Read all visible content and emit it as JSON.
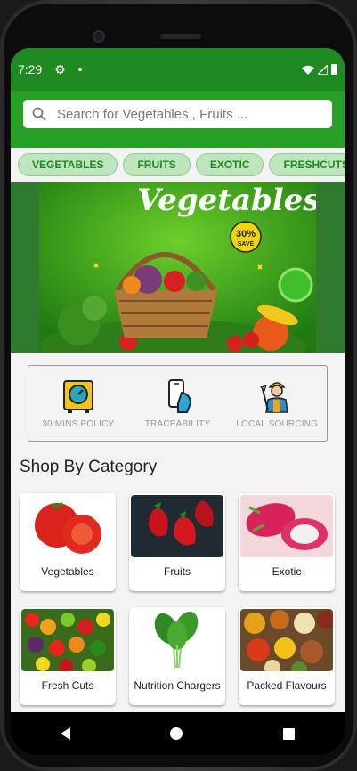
{
  "status_bar": {
    "time": "7:29",
    "icons": [
      "settings-icon",
      "notification-dot-icon",
      "wifi-icon",
      "signal-icon",
      "battery-icon"
    ]
  },
  "search": {
    "placeholder": "Search for Vegetables , Fruits ..."
  },
  "filter_chips": [
    {
      "label": "VEGETABLES"
    },
    {
      "label": "FRUITS"
    },
    {
      "label": "EXOTIC"
    },
    {
      "label": "FRESHCUTS"
    }
  ],
  "banner": {
    "title": "Vegetables",
    "badge_percent": "30%",
    "badge_text": "SAVE"
  },
  "features": [
    {
      "label": "30 MINS POLICY",
      "icon": "timer-box-icon"
    },
    {
      "label": "TRACEABILITY",
      "icon": "phone-hand-icon"
    },
    {
      "label": "LOCAL SOURCING",
      "icon": "farmer-icon"
    }
  ],
  "section": {
    "title": "Shop By Category"
  },
  "categories": [
    {
      "name": "Vegetables"
    },
    {
      "name": "Fruits"
    },
    {
      "name": "Exotic"
    },
    {
      "name": "Fresh Cuts"
    },
    {
      "name": "Nutrition Chargers"
    },
    {
      "name": "Packed Flavours"
    }
  ],
  "colors": {
    "primary": "#26a026",
    "status": "#1f8a1f",
    "chip_bg": "#bfe5bf",
    "chip_text": "#1f8a1f"
  }
}
